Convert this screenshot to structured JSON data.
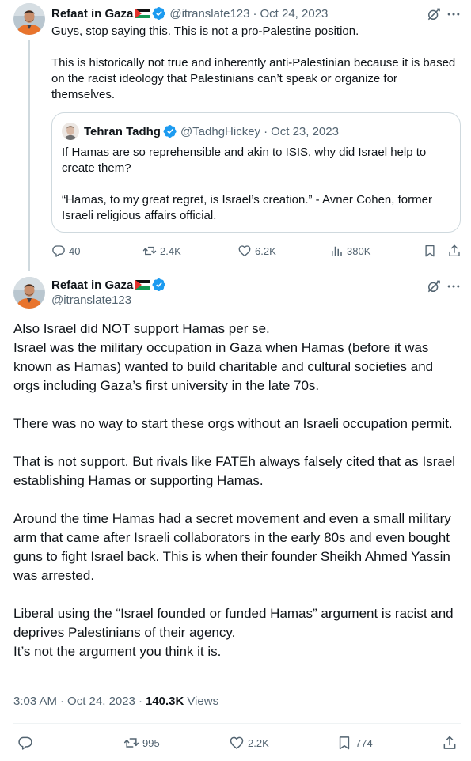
{
  "tweet1": {
    "author_name": "Refaat in Gaza",
    "handle": "@itranslate123",
    "separator": "·",
    "date": "Oct 24, 2023",
    "text": "Guys, stop saying this. This is not a pro-Palestine position.\n\nThis is historically not true and inherently anti-Palestinian because it is based on the racist ideology that Palestinians can’t speak or organize for themselves.",
    "quote": {
      "author_name": "Tehran Tadhg",
      "handle": "@TadhgHickey",
      "separator": "·",
      "date": "Oct 23, 2023",
      "text": "If Hamas are so reprehensible and akin to ISIS, why did Israel help to create them?\n\n“Hamas, to my great regret, is Israel’s creation.” - Avner Cohen, former Israeli religious affairs official."
    },
    "actions": {
      "replies": "40",
      "reposts": "2.4K",
      "likes": "6.2K",
      "views": "380K"
    }
  },
  "tweet2": {
    "author_name": "Refaat in Gaza",
    "handle": "@itranslate123",
    "text": "Also Israel did NOT support Hamas per se.\nIsrael was the military occupation in Gaza when Hamas (before it was known as Hamas) wanted to build charitable and cultural societies and orgs including Gaza’s first university in the late 70s.\n\nThere was no way to start these orgs without an Israeli occupation permit.\n\nThat is not support. But rivals like FATEh always falsely cited that as Israel establishing Hamas or supporting Hamas.\n\nAround the time Hamas had a secret movement and even a small military arm that came after Israeli collaborators in the early 80s and even bought guns to fight Israel back. This is when their founder Sheikh Ahmed Yassin was arrested.\n\nLiberal using the “Israel founded or funded Hamas” argument is racist and deprives Palestinians of their agency.\nIt’s not the argument you think it is.",
    "time": "3:03 AM",
    "separator": "·",
    "date": "Oct 24, 2023",
    "views_count": "140.3K",
    "views_label": "Views",
    "actions": {
      "reposts": "995",
      "likes": "2.2K",
      "bookmarks": "774"
    }
  },
  "icons": [
    "avatar",
    "palestine-flag",
    "verified-badge",
    "grok-icon",
    "more-icon",
    "reply-icon",
    "repost-icon",
    "like-icon",
    "views-icon",
    "bookmark-icon",
    "share-icon"
  ],
  "colors": {
    "text": "#0f1419",
    "muted": "#536471",
    "verified": "#1d9bf0",
    "border": "#cfd9de",
    "divider": "#eff3f4"
  }
}
